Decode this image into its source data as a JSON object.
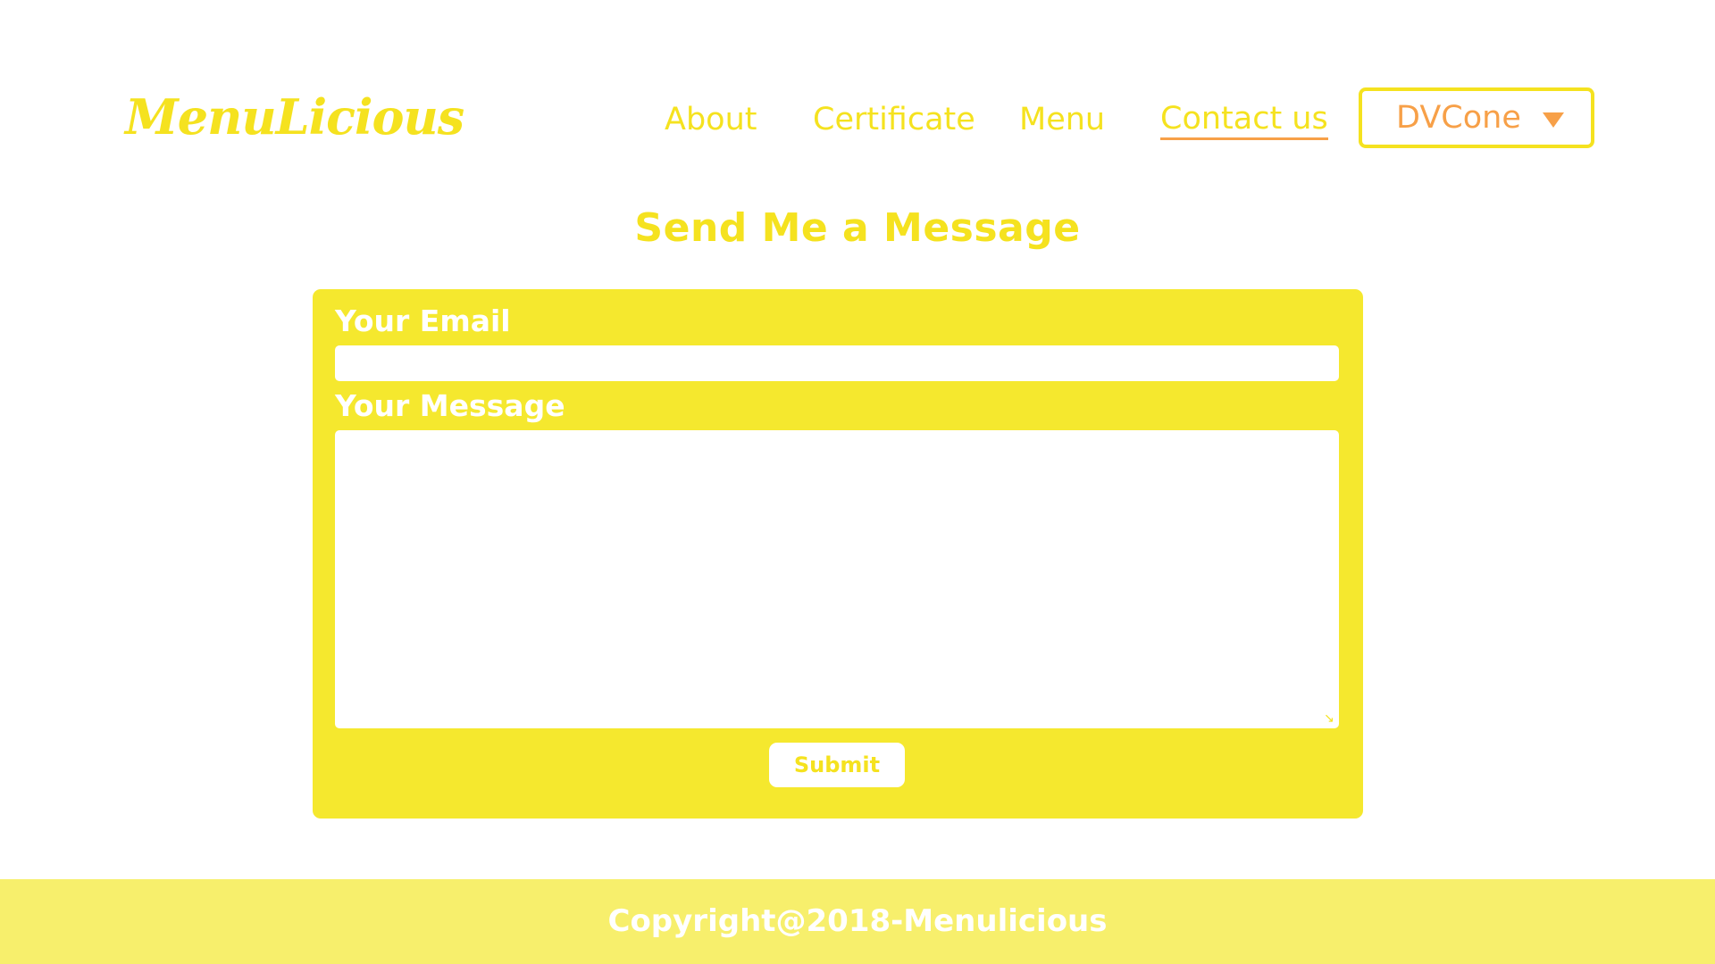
{
  "brand": {
    "logo_text": "MenuLicious"
  },
  "nav": {
    "items": [
      {
        "label": "About"
      },
      {
        "label": "Certificate"
      },
      {
        "label": "Menu"
      },
      {
        "label": "Contact us",
        "active": true
      }
    ],
    "dropdown": {
      "selected": "DVCone",
      "icon": "caret-down-icon"
    }
  },
  "main": {
    "heading": "Send Me a Message",
    "form": {
      "email_label": "Your Email",
      "email_value": "",
      "message_label": "Your Message",
      "message_value": "",
      "submit_label": "Submit"
    }
  },
  "footer": {
    "copyright": "Copyright@2018-Menulicious"
  },
  "colors": {
    "primary_yellow": "#f5e21f",
    "form_background": "#f5e82e",
    "accent_orange": "#f7a048",
    "footer_background": "#f7ef6c",
    "page_background": "#ffffff"
  }
}
